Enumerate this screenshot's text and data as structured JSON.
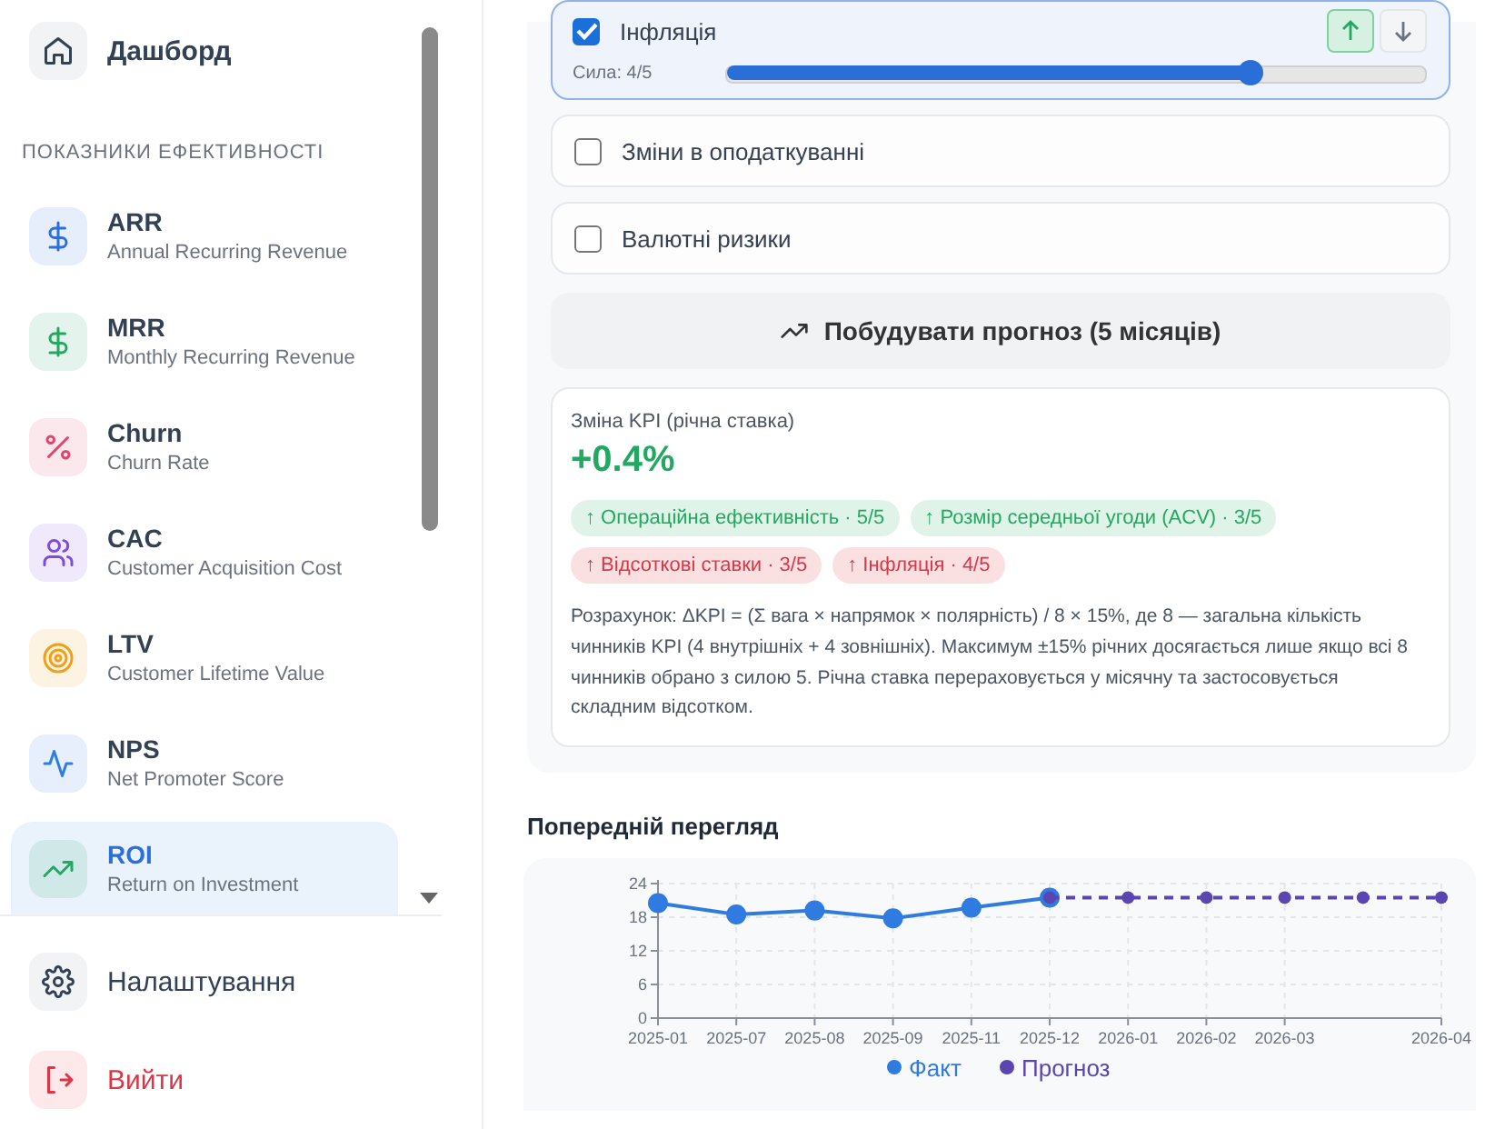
{
  "sidebar": {
    "top_items": [
      {
        "label": "Дашборд",
        "selected": false
      }
    ],
    "section_title": "ПОКАЗНИКИ ЕФЕКТИВНОСТІ",
    "kpis": [
      {
        "name": "ARR",
        "description": "Annual Recurring Revenue",
        "color": "#2f6fdc",
        "selected": false
      },
      {
        "name": "MRR",
        "description": "Monthly Recurring Revenue",
        "color": "#22a860",
        "selected": false
      },
      {
        "name": "Churn",
        "description": "Churn Rate",
        "color": "#e0456e",
        "selected": false
      },
      {
        "name": "CAC",
        "description": "Customer Acquisition Cost",
        "color": "#7c4ddc",
        "selected": false
      },
      {
        "name": "LTV",
        "description": "Customer Lifetime Value",
        "color": "#f0a018",
        "selected": false
      },
      {
        "name": "NPS",
        "description": "Net Promoter Score",
        "color": "#2f7fe0",
        "selected": false
      },
      {
        "name": "ROI",
        "description": "Return on Investment",
        "color": "#22a860",
        "selected": true
      }
    ],
    "footer": [
      {
        "label": "Налаштування",
        "kind": "settings"
      },
      {
        "label": "Вийти",
        "kind": "logout"
      }
    ]
  },
  "factors": [
    {
      "label": "Інфляція",
      "checked": true,
      "strength_label": "Сила: 4/5",
      "level": 0.75,
      "directions": [
        {
          "kind": "up",
          "selected": true
        },
        {
          "kind": "down",
          "selected": false
        }
      ]
    },
    {
      "label": "Зміни в оподаткуванні",
      "checked": false
    },
    {
      "label": "Валютні ризики",
      "checked": false
    }
  ],
  "build_button": "Побудувати прогноз (5 місяців)",
  "result": {
    "label": "Зміна KPI (річна ставка)",
    "value": "+0.4%",
    "tags": [
      {
        "text": "↑ Операційна ефективність · 5/5",
        "kind": "positive"
      },
      {
        "text": "↑ Розмір середньої угоди (ACV) · 3/5",
        "kind": "positive"
      },
      {
        "text": "↑ Відсоткові ставки · 3/5",
        "kind": "negative"
      },
      {
        "text": "↑ Інфляція · 4/5",
        "kind": "negative"
      }
    ],
    "note": "Розрахунок: ΔKPI = (Σ вага × напрямок × полярність) / 8 × 15%, де 8 — загальна кількість чинників KPI (4 внутрішніх + 4 зовнішніх). Максимум ±15% річних досягається лише якщо всі 8 чинників обрано з силою 5. Річна ставка перераховується у місячну та застосовується складним відсотком."
  },
  "preview": {
    "title": "Попередній перегляд",
    "chart_data": {
      "type": "line",
      "categories": [
        "2025-01",
        "2025-07",
        "2025-08",
        "2025-09",
        "2025-11",
        "2025-12",
        "2026-01",
        "2026-02",
        "2026-03",
        null,
        "2026-04"
      ],
      "ylim": [
        0,
        24
      ],
      "yticks": [
        0,
        6,
        12,
        18,
        24
      ],
      "grid": true,
      "legend": true,
      "series": [
        {
          "name": "Факт",
          "color": "#2f7be0",
          "marker": "circle",
          "line_style": "solid",
          "values": [
            20.5,
            18.5,
            19.2,
            17.8,
            19.7,
            21.5,
            null,
            null,
            null,
            null,
            null
          ]
        },
        {
          "name": "Прогноз",
          "color": "#5b45b0",
          "marker": "circle",
          "line_style": "dashed",
          "values": [
            null,
            null,
            null,
            null,
            null,
            21.5,
            21.5,
            21.5,
            21.5,
            21.5,
            21.5
          ]
        }
      ]
    }
  }
}
